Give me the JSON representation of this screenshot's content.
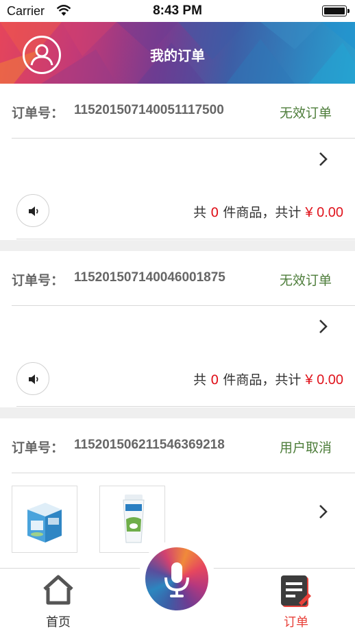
{
  "status_bar": {
    "carrier": "Carrier",
    "time": "8:43 PM"
  },
  "header": {
    "title": "我的订单"
  },
  "orders": [
    {
      "no_label": "订单号：",
      "no": "115201507140051117500",
      "status": "无效订单",
      "summary_prefix": "共",
      "count": "0",
      "summary_mid": "件商品，共计",
      "amount": "¥ 0.00"
    },
    {
      "no_label": "订单号：",
      "no": "115201507140046001875",
      "status": "无效订单",
      "summary_prefix": "共",
      "count": "0",
      "summary_mid": "件商品，共计",
      "amount": "¥ 0.00"
    },
    {
      "no_label": "订单号：",
      "no": "115201506211546369218",
      "status": "用户取消",
      "products": [
        "milk-carton-image",
        "yogurt-cup-image"
      ]
    }
  ],
  "tabbar": {
    "home_label": "首页",
    "order_label": "订单"
  },
  "colors": {
    "status_green": "#4d7d3a",
    "price_red": "#e0141d",
    "active_tab": "#e8413a"
  }
}
